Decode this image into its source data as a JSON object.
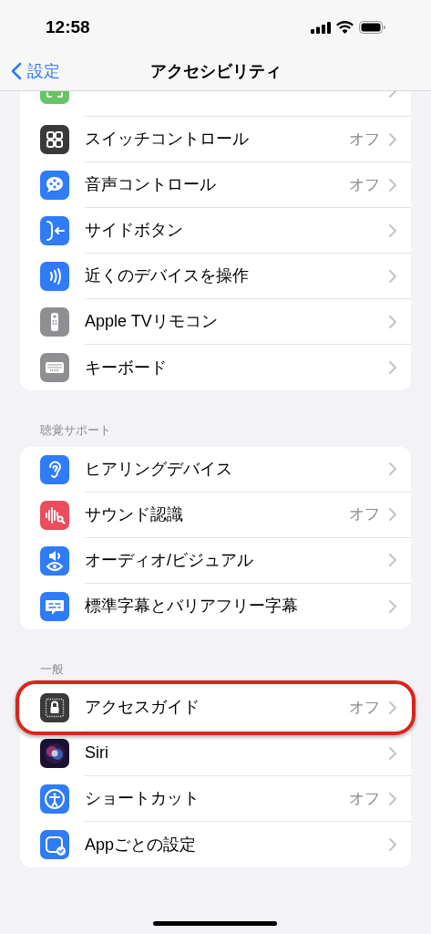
{
  "status_bar": {
    "time": "12:58"
  },
  "nav": {
    "back": "設定",
    "title": "アクセシビリティ"
  },
  "sections": [
    {
      "items": [
        {
          "label": "スイッチコントロール",
          "value": "オフ",
          "highlighted": false
        },
        {
          "label": "音声コントロール",
          "value": "オフ",
          "highlighted": false
        },
        {
          "label": "サイドボタン",
          "highlighted": false
        },
        {
          "label": "近くのデバイスを操作",
          "highlighted": false
        },
        {
          "label": "Apple TVリモコン",
          "highlighted": false
        },
        {
          "label": "キーボード",
          "highlighted": false
        }
      ]
    },
    {
      "header": "聴覚サポート",
      "items": [
        {
          "label": "ヒアリングデバイス",
          "highlighted": false
        },
        {
          "label": "サウンド認識",
          "value": "オフ",
          "highlighted": false
        },
        {
          "label": "オーディオ/ビジュアル",
          "highlighted": false
        },
        {
          "label": "標準字幕とバリアフリー字幕",
          "highlighted": false
        }
      ]
    },
    {
      "header": "一般",
      "items": [
        {
          "label": "アクセスガイド",
          "value": "オフ",
          "highlighted": true
        },
        {
          "label": "Siri",
          "highlighted": false
        },
        {
          "label": "ショートカット",
          "value": "オフ",
          "highlighted": false
        },
        {
          "label": "Appごとの設定",
          "highlighted": false
        }
      ]
    }
  ]
}
